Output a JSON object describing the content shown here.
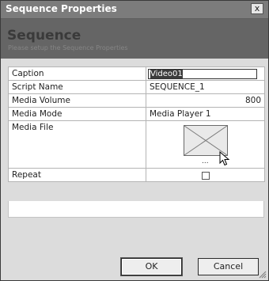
{
  "window": {
    "title": "Sequence Properties",
    "close_glyph": "x"
  },
  "header": {
    "title": "Sequence",
    "subtitle": "Please setup the Sequence Properties"
  },
  "properties": {
    "caption": {
      "label": "Caption",
      "value": "Video01"
    },
    "script_name": {
      "label": "Script Name",
      "value": "SEQUENCE_1"
    },
    "media_volume": {
      "label": "Media Volume",
      "value": "800"
    },
    "media_mode": {
      "label": "Media Mode",
      "value": "Media Player 1"
    },
    "media_file": {
      "label": "Media File",
      "browse_label": "...",
      "placeholder_icon": "image-placeholder-icon"
    },
    "repeat": {
      "label": "Repeat",
      "checked": false
    }
  },
  "buttons": {
    "ok": "OK",
    "cancel": "Cancel"
  }
}
